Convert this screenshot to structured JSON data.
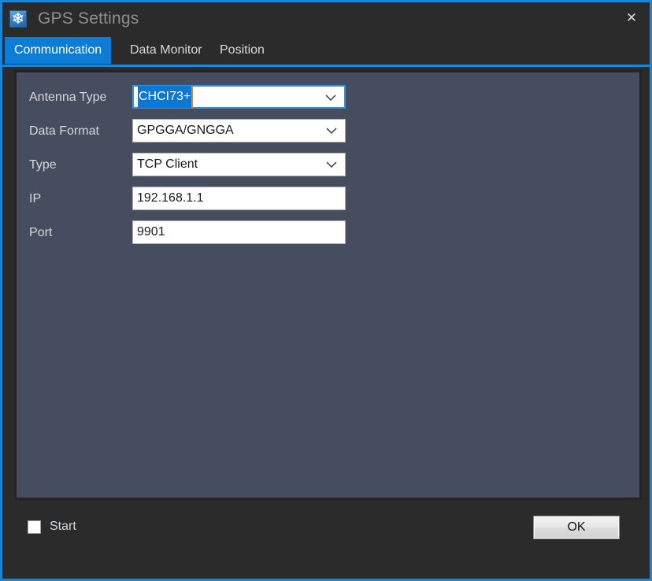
{
  "window": {
    "title": "GPS Settings",
    "icon": "snowflake-icon",
    "close_label": "✕",
    "frame_color": "#1b86d4",
    "titlebar_color": "#2b2b2b",
    "panel_color": "#464d5e"
  },
  "tabs": [
    {
      "label": "Communication",
      "active": true
    },
    {
      "label": "Data Monitor",
      "active": false
    },
    {
      "label": "Position",
      "active": false
    }
  ],
  "form": {
    "rows": [
      {
        "label": "Antenna Type",
        "value": "CHCI73+",
        "control": "combobox",
        "focused": true,
        "selected": true
      },
      {
        "label": "Data Format",
        "value": "GPGGA/GNGGA",
        "control": "combobox",
        "focused": false,
        "selected": false
      },
      {
        "label": "Type",
        "value": "TCP Client",
        "control": "combobox",
        "focused": false,
        "selected": false
      },
      {
        "label": "IP",
        "value": "192.168.1.1",
        "control": "textbox",
        "focused": false,
        "selected": false
      },
      {
        "label": "Port",
        "value": "9901",
        "control": "textbox",
        "focused": false,
        "selected": false
      }
    ]
  },
  "footer": {
    "start_label": "Start",
    "start_checked": false,
    "ok_label": "OK"
  },
  "colors": {
    "accent": "#0c7cd5",
    "selection": "#0a78d4",
    "caret": "#d98a2b",
    "label_text": "#d5d8dd",
    "title_text": "#8e8e8e"
  }
}
